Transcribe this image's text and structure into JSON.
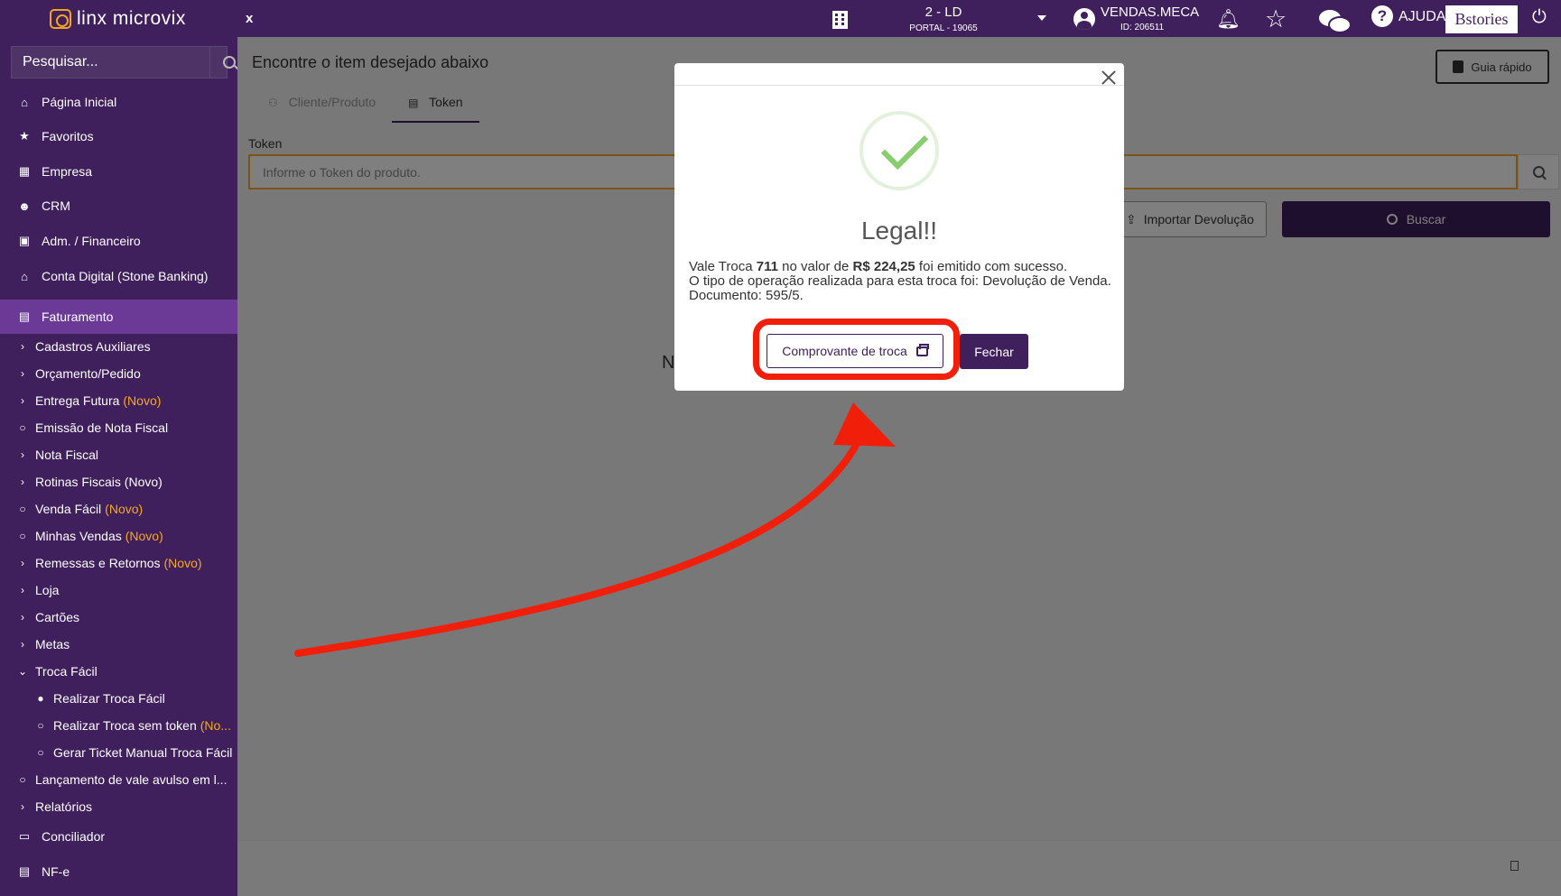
{
  "topbar": {
    "logo_text": "linx microvix",
    "close_label": "x",
    "store_name": "2 - LD",
    "store_sub": "PORTAL - 19065",
    "user_name": "VENDAS.MECA",
    "user_id": "ID: 206511",
    "help_label": "AJUDA",
    "brand": "Bstories"
  },
  "sidebar": {
    "search_placeholder": "Pesquisar...",
    "items": [
      {
        "label": "Página Inicial",
        "icon": "home-icon"
      },
      {
        "label": "Favoritos",
        "icon": "star-icon"
      },
      {
        "label": "Empresa",
        "icon": "building-icon"
      },
      {
        "label": "CRM",
        "icon": "users-icon"
      },
      {
        "label": "Adm. / Financeiro",
        "icon": "money-icon"
      },
      {
        "label": "Conta Digital (Stone Banking)",
        "icon": "bank-icon"
      },
      {
        "label": "Faturamento",
        "icon": "file-icon"
      }
    ],
    "sub": [
      {
        "label": "Cadastros Auxiliares",
        "novo": ""
      },
      {
        "label": "Orçamento/Pedido",
        "novo": ""
      },
      {
        "label": "Entrega Futura",
        "novo": "(Novo)"
      },
      {
        "label": "Emissão de Nota Fiscal",
        "novo": ""
      },
      {
        "label": "Nota Fiscal",
        "novo": ""
      },
      {
        "label": "Rotinas Fiscais (Novo)",
        "novo": ""
      },
      {
        "label": "Venda Fácil",
        "novo": "(Novo)"
      },
      {
        "label": "Minhas Vendas",
        "novo": "(Novo)"
      },
      {
        "label": "Remessas e Retornos",
        "novo": "(Novo)"
      },
      {
        "label": "Loja",
        "novo": ""
      },
      {
        "label": "Cartões",
        "novo": ""
      },
      {
        "label": "Metas",
        "novo": ""
      },
      {
        "label": "Troca Fácil",
        "novo": ""
      },
      {
        "label": "Realizar Troca Fácil",
        "novo": ""
      },
      {
        "label": "Realizar Troca sem token",
        "novo": "(No..."
      },
      {
        "label": "Gerar Ticket Manual Troca Fácil",
        "novo": ""
      },
      {
        "label": "Lançamento de vale avulso em l...",
        "novo": ""
      },
      {
        "label": "Relatórios",
        "novo": ""
      }
    ],
    "bottom": [
      {
        "label": "Conciliador",
        "icon": "card-icon"
      },
      {
        "label": "NF-e",
        "icon": "document-icon"
      }
    ]
  },
  "main": {
    "title": "Encontre o item desejado abaixo",
    "guide_label": "Guia rápido",
    "tabs": [
      {
        "label": "Cliente/Produto"
      },
      {
        "label": "Token"
      }
    ],
    "token_label": "Token",
    "token_placeholder": "Informe o Token do produto.",
    "import_label": "Importar Devolução",
    "search_label": "Buscar",
    "hidden_text": "N"
  },
  "modal": {
    "title": "Legal!!",
    "line1_prefix": "Vale Troca ",
    "voucher_number": "711",
    "line1_mid": " no valor de ",
    "amount": "R$ 224,25",
    "line1_suffix": " foi emitido com sucesso.",
    "line2": "O tipo de operação realizada para esta troca foi: Devolução de Venda.",
    "line3": "Documento: 595/5.",
    "receipt_label": "Comprovante de troca",
    "close_label": "Fechar"
  },
  "colors": {
    "brand_purple": "#3f1f5c",
    "active_purple": "#6a3a96",
    "accent_orange": "#f7a823",
    "annotation_red": "#f11f0a",
    "success_green": "#8acd6e"
  }
}
